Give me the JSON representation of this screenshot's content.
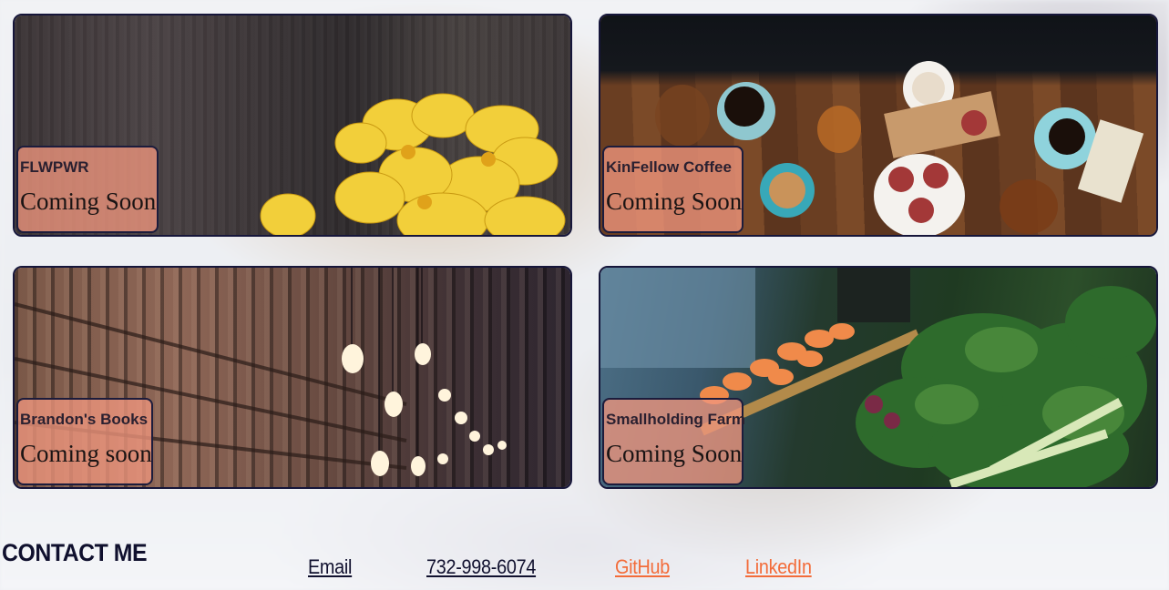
{
  "cards": [
    {
      "name": "FLWPWR",
      "status": "Coming Soon"
    },
    {
      "name": "KinFellow Coffee",
      "status": "Coming Soon"
    },
    {
      "name": "Brandon's Books",
      "status": "Coming soon"
    },
    {
      "name": "Smallholding Farm",
      "status": "Coming Soon"
    }
  ],
  "contact": {
    "title": "CONTACT ME",
    "email": "Email",
    "phone": "732-998-6074",
    "github": "GitHub",
    "linkedin": "LinkedIn"
  },
  "colors": {
    "card_border": "#16163a",
    "label_fill": "#f0967d",
    "heading": "#10102e",
    "link_accent": "#f36c3a"
  }
}
